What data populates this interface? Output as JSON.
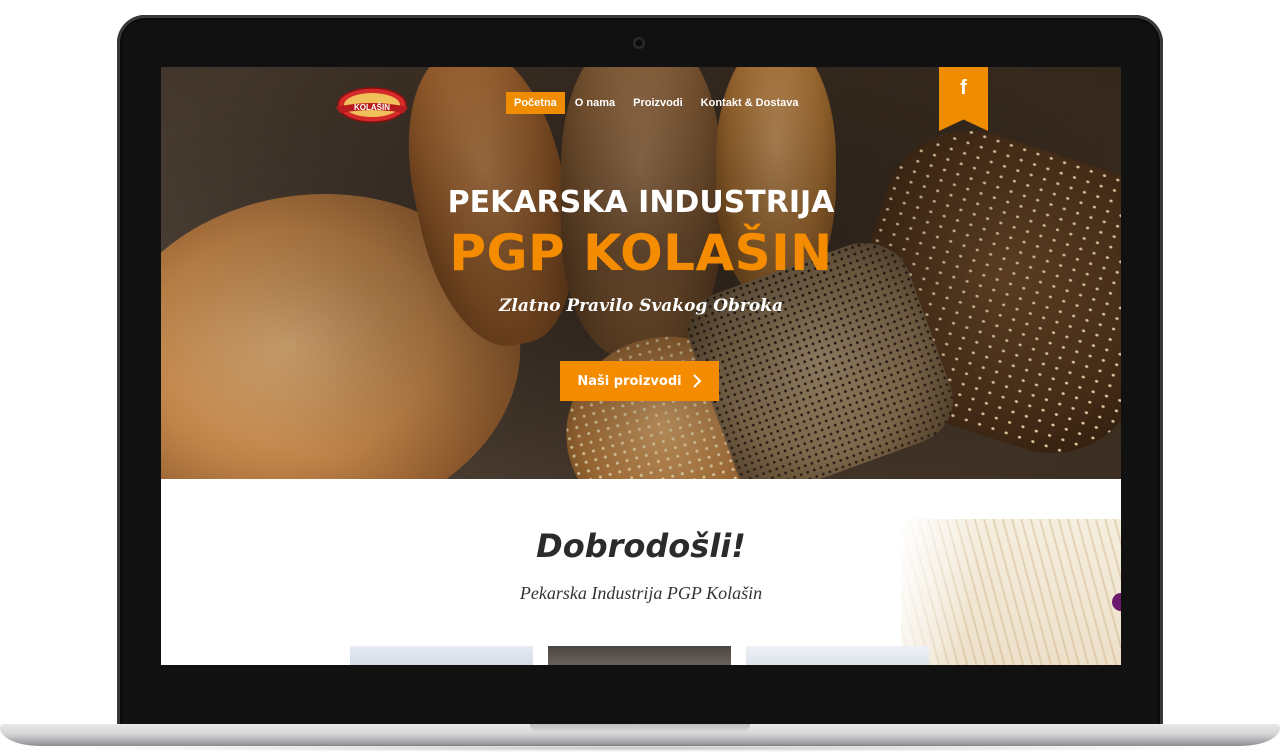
{
  "nav": {
    "items": [
      {
        "label": "Početna",
        "active": true
      },
      {
        "label": "O nama",
        "active": false
      },
      {
        "label": "Proizvodi",
        "active": false
      },
      {
        "label": "Kontakt & Dostava",
        "active": false
      }
    ]
  },
  "social": {
    "facebook_glyph": "f",
    "icon": "facebook-icon"
  },
  "hero": {
    "title": "PEKARSKA INDUSTRIJA",
    "brand": "PGP KOLAŠIN",
    "tagline": "Zlatno Pravilo Svakog Obroka",
    "cta_label": "Naši proizvodi",
    "cta_icon": "chevron-right-icon"
  },
  "welcome": {
    "title": "Dobrodošli!",
    "subtitle": "Pekarska Industrija PGP Kolašin"
  },
  "logo": {
    "text": "KOLAŠIN"
  },
  "colors": {
    "accent": "#f58c00",
    "logo_red": "#d42a2a",
    "text_dark": "#2b2b2b"
  }
}
